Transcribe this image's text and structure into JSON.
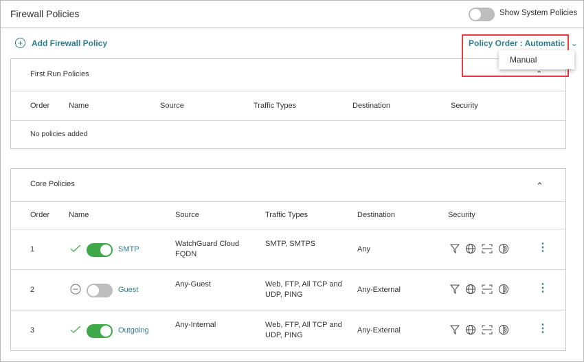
{
  "header": {
    "title": "Firewall Policies",
    "show_system_label": "Show System Policies",
    "show_system_on": false
  },
  "toolbar": {
    "add_label": "Add Firewall Policy",
    "order_label": "Policy Order : Automatic",
    "order_options": [
      "Manual"
    ]
  },
  "columns": {
    "order": "Order",
    "name": "Name",
    "source": "Source",
    "traffic": "Traffic Types",
    "destination": "Destination",
    "security": "Security"
  },
  "first_run": {
    "title": "First Run Policies",
    "empty": "No policies added"
  },
  "core": {
    "title": "Core Policies",
    "rows": [
      {
        "order": "1",
        "status": "enabled",
        "enabled": true,
        "name": "SMTP",
        "source": "WatchGuard Cloud FQDN",
        "traffic": "SMTP, SMTPS",
        "destination": "Any"
      },
      {
        "order": "2",
        "status": "disabled",
        "enabled": false,
        "name": "Guest",
        "source": "Any-Guest",
        "traffic": "Web, FTP, All TCP and UDP, PING",
        "destination": "Any-External"
      },
      {
        "order": "3",
        "status": "enabled",
        "enabled": true,
        "name": "Outgoing",
        "source": "Any-Internal",
        "traffic": "Web, FTP, All TCP and UDP, PING",
        "destination": "Any-External"
      }
    ]
  },
  "colors": {
    "accent": "#2e7f8c",
    "toggle_on": "#3fa94a",
    "highlight": "#e53b3b"
  }
}
